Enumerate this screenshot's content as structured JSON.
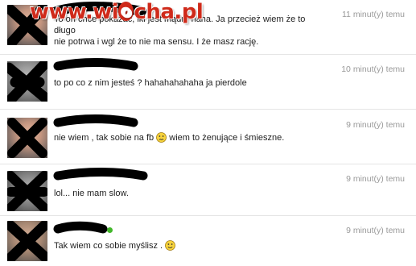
{
  "watermark": {
    "text_before": "www.wi",
    "text_o": "o",
    "text_after": "cha.pl"
  },
  "messages": [
    {
      "time": "11 minut(y) temu",
      "line1": "To on chce pokazać, iki jest mądry haha. Ja przecież wiem że to długo",
      "line2": "nie potrwa i wgl że to nie ma sensu. I że masz rację."
    },
    {
      "time": "10 minut(y) temu",
      "line1": "to po co z nim jesteś ? hahahahahaha ja pierdole"
    },
    {
      "time": "9 minut(y) temu",
      "line1_a": "nie wiem , tak sobie na fb",
      "line1_b": "wiem to żenujące i śmieszne.",
      "emoticon": "confused-face-icon"
    },
    {
      "time": "9 minut(y) temu",
      "line1": "lol... nie mam slow."
    },
    {
      "time": "9 minut(y) temu",
      "line1": "Tak wiem co sobie myślisz .",
      "emoticon": "smile-face-icon",
      "online": true,
      "online_color": "#42b72a"
    }
  ]
}
